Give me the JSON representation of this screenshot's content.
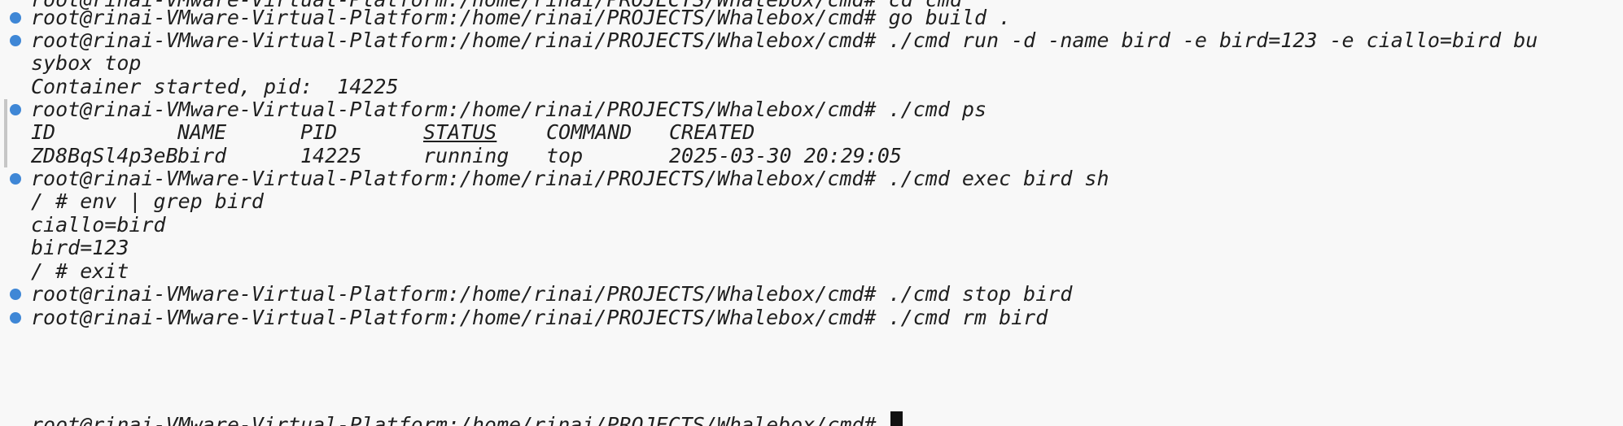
{
  "prompt": "root@rinai-VMware-Virtual-Platform:/home/rinai/PROJECTS/Whalebox/cmd#",
  "lines": {
    "clipped_top": "root@rinai-VMware-Virtual-Platform:/home/rinai/PROJECTS/Whalebox/cmd# cd cmd",
    "cmd_build": "go build .",
    "cmd_run": "./cmd run -d -name bird -e bird=123 -e ciallo=bird bu",
    "run_wrap": "sybox top",
    "run_output": "Container started, pid:  14225",
    "cmd_ps": "./cmd ps",
    "cmd_exec": "./cmd exec bird sh",
    "shell_1": "/ # env | grep bird",
    "shell_2": "ciallo=bird",
    "shell_3": "bird=123",
    "shell_4": "/ # exit",
    "cmd_stop": "./cmd stop bird",
    "cmd_rm": "./cmd rm bird"
  },
  "ps_table": {
    "headers": {
      "id": "ID",
      "name": "NAME",
      "pid": "PID",
      "status": "STATUS",
      "command": "COMMAND",
      "created": "CREATED"
    },
    "row": {
      "id": "ZD8BqSl4p3eB",
      "name": "bird",
      "pid": "14225",
      "status": "running",
      "command": "top",
      "created": "2025-03-30 20:29:05"
    }
  },
  "colors": {
    "background": "#f8f8f8",
    "text": "#1f1f1f",
    "status_dot": "#3f87d6",
    "cursor": "#111111"
  }
}
